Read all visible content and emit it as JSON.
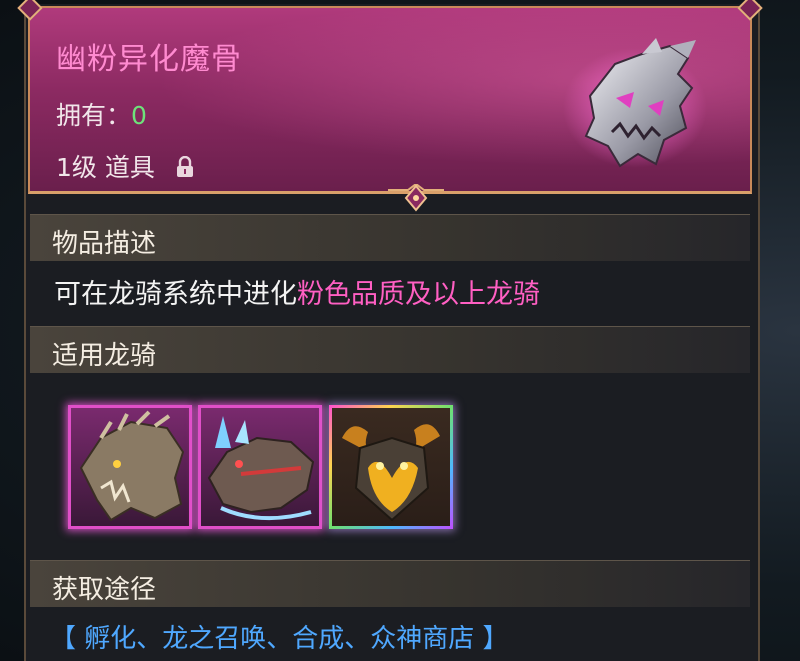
{
  "item": {
    "name": "幽粉异化魔骨",
    "owned_label": "拥有：",
    "owned_count": "0",
    "level_label": "1级 道具"
  },
  "sections": {
    "description_title": "物品描述",
    "description_text": "可在龙骑系统中进化",
    "description_highlight": "粉色品质及以上龙骑",
    "applicable_title": "适用龙骑",
    "source_title": "获取途径",
    "source_text": "【 孵化、龙之召唤、合成、众神商店 】"
  },
  "riders": [
    {
      "quality": "pink",
      "icon": "bone-dragon-head-icon"
    },
    {
      "quality": "pink",
      "icon": "ice-dragon-head-icon"
    },
    {
      "quality": "rainbow",
      "icon": "flame-demon-dragon-icon"
    }
  ],
  "colors": {
    "title_pink": "#ff8ad0",
    "owned_green": "#6ee27a",
    "highlight_pink": "#ff5fc3",
    "source_blue": "#4fa8ff",
    "header_bg": "#9a3070"
  }
}
